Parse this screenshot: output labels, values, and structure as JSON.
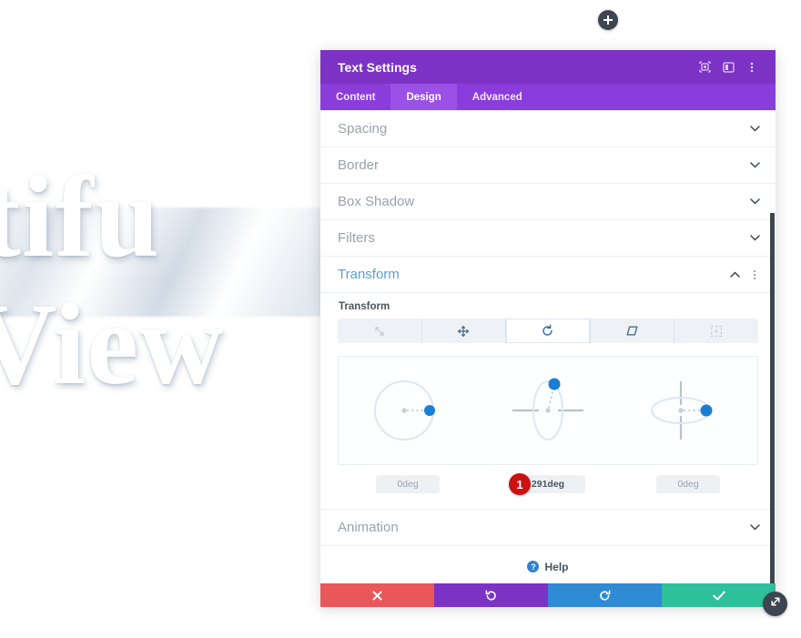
{
  "background": {
    "hero_line_1": "utifu",
    "hero_line_2": "View"
  },
  "add_button": {
    "icon": "plus-icon"
  },
  "modal": {
    "title": "Text Settings",
    "header_icons": [
      {
        "name": "focus-target-icon"
      },
      {
        "name": "panel-layout-icon"
      },
      {
        "name": "kebab-menu-icon"
      }
    ],
    "tabs": [
      {
        "label": "Content",
        "active": false
      },
      {
        "label": "Design",
        "active": true
      },
      {
        "label": "Advanced",
        "active": false
      }
    ],
    "sections": [
      {
        "label": "Spacing",
        "open": false
      },
      {
        "label": "Border",
        "open": false
      },
      {
        "label": "Box Shadow",
        "open": false
      },
      {
        "label": "Filters",
        "open": false
      },
      {
        "label": "Transform",
        "open": true
      },
      {
        "label": "Animation",
        "open": false
      }
    ],
    "transform": {
      "field_label": "Transform",
      "modes": [
        {
          "name": "scale-icon",
          "label": "Scale",
          "state": "dim"
        },
        {
          "name": "move-icon",
          "label": "Translate",
          "state": "normal"
        },
        {
          "name": "rotate-icon",
          "label": "Rotate",
          "state": "active"
        },
        {
          "name": "skew-icon",
          "label": "Skew",
          "state": "normal"
        },
        {
          "name": "origin-icon",
          "label": "Origin",
          "state": "dim"
        }
      ],
      "axes": [
        {
          "axis": "x",
          "value": "0deg",
          "active": false,
          "badge": null
        },
        {
          "axis": "y",
          "value": "291deg",
          "active": true,
          "badge": "1"
        },
        {
          "axis": "z",
          "value": "0deg",
          "active": false,
          "badge": null
        }
      ]
    },
    "help": {
      "label": "Help",
      "icon_glyph": "?"
    },
    "footer": [
      {
        "name": "cancel-button",
        "icon": "close-icon"
      },
      {
        "name": "undo-button",
        "icon": "undo-icon"
      },
      {
        "name": "redo-button",
        "icon": "redo-icon"
      },
      {
        "name": "save-button",
        "icon": "check-icon"
      }
    ]
  },
  "resize_handle": {
    "icon": "resize-diagonal-icon"
  },
  "colors": {
    "header_purple": "#7c32c4",
    "tabbar_purple": "#8b3ddb",
    "tab_active": "#9a51e6",
    "accent_blue": "#2f6ea5",
    "handle_blue": "#1a7fd4",
    "badge_red": "#cc1111",
    "cancel_red": "#e9575a",
    "undo_purple": "#7d32c6",
    "redo_blue": "#2f8bd4",
    "save_green": "#2ec09a"
  }
}
